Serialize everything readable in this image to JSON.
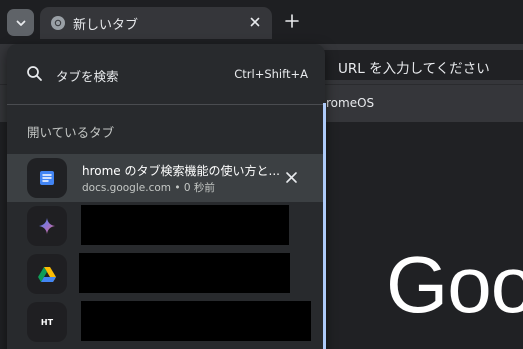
{
  "tabstrip": {
    "active_tab": {
      "title": "新しいタブ",
      "favicon": "chrome-icon"
    },
    "tab_search_button": "chevron-down-icon",
    "new_tab_button": "plus-icon"
  },
  "background_page": {
    "omnibox_placeholder": "URL を入力してください",
    "bookmark_partial": "romeOS",
    "logo_partial": "Goo"
  },
  "tab_search": {
    "placeholder": "タブを検索",
    "shortcut": "Ctrl+Shift+A",
    "section_title": "開いているタブ",
    "items": [
      {
        "title": "hrome のタブ検索機能の使い方と...",
        "subtitle": "docs.google.com • 0 秒前",
        "icon": "google-docs-icon",
        "selected": true
      },
      {
        "title": "",
        "subtitle": "",
        "icon": "gemini-icon",
        "selected": false
      },
      {
        "title": "",
        "subtitle": "",
        "icon": "google-drive-icon",
        "selected": false
      },
      {
        "title": "",
        "subtitle": "",
        "icon": "ht-icon",
        "icon_text": "HT",
        "selected": false
      }
    ]
  },
  "colors": {
    "accent": "#8ab4f8",
    "popup_bg": "#282a2d",
    "docs_blue": "#4285f4"
  }
}
